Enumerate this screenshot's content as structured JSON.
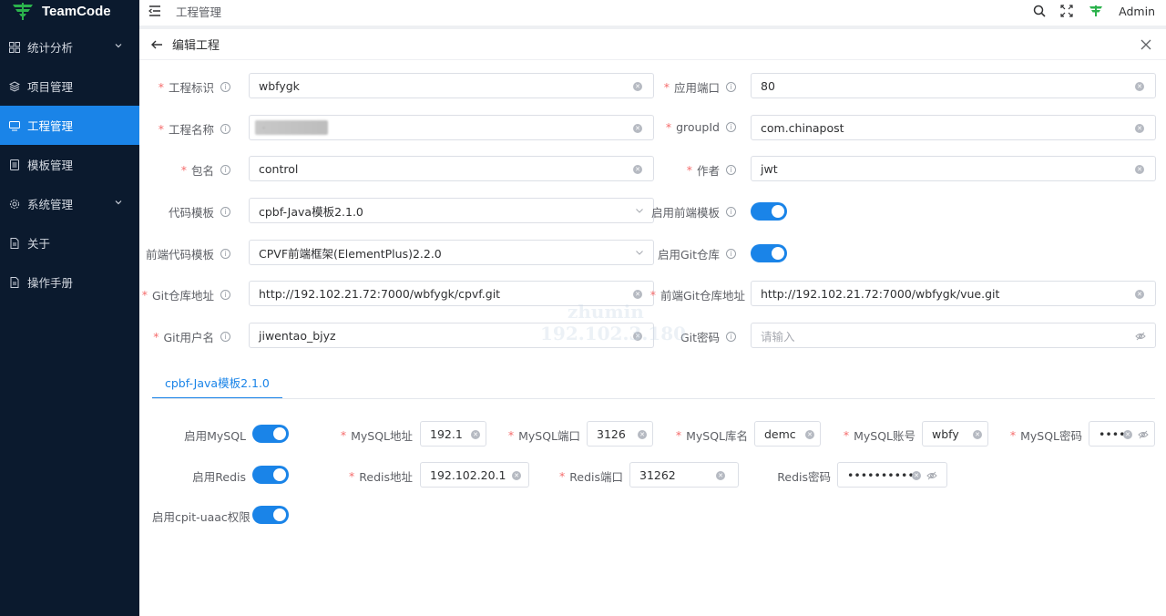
{
  "app": {
    "logo_text": "TeamCode"
  },
  "sidebar": {
    "items": [
      {
        "label": "统计分析",
        "icon": "grid-icon",
        "has_children": true,
        "active": false
      },
      {
        "label": "项目管理",
        "icon": "layers-icon",
        "has_children": false,
        "active": false
      },
      {
        "label": "工程管理",
        "icon": "monitor-icon",
        "has_children": false,
        "active": true
      },
      {
        "label": "模板管理",
        "icon": "file-list-icon",
        "has_children": false,
        "active": false
      },
      {
        "label": "系统管理",
        "icon": "gear-icon",
        "has_children": true,
        "active": false
      },
      {
        "label": "关于",
        "icon": "document-icon",
        "has_children": false,
        "active": false
      },
      {
        "label": "操作手册",
        "icon": "document-icon",
        "has_children": false,
        "active": false
      }
    ]
  },
  "header": {
    "breadcrumb": "工程管理",
    "user": "Admin"
  },
  "page": {
    "title": "编辑工程"
  },
  "form": {
    "project_id": {
      "label": "工程标识",
      "value": "wbfygk"
    },
    "port": {
      "label": "应用端口",
      "value": "80"
    },
    "project_name": {
      "label": "工程名称",
      "value": "·"
    },
    "group_id": {
      "label": "groupId",
      "value": "com.chinapost"
    },
    "package": {
      "label": "包名",
      "value": "control"
    },
    "author": {
      "label": "作者",
      "value": "jwt"
    },
    "code_template": {
      "label": "代码模板",
      "value": "cpbf-Java模板2.1.0"
    },
    "enable_front_template": {
      "label": "启用前端模板",
      "on": true
    },
    "front_template": {
      "label": "前端代码模板",
      "value": "CPVF前端框架(ElementPlus)2.2.0"
    },
    "enable_git": {
      "label": "启用Git仓库",
      "on": true
    },
    "git_url": {
      "label": "Git仓库地址",
      "value": "http://192.102.21.72:7000/wbfygk/cpvf.git"
    },
    "front_git_url": {
      "label": "前端Git仓库地址",
      "value": "http://192.102.21.72:7000/wbfygk/vue.git"
    },
    "git_user": {
      "label": "Git用户名",
      "value": "jiwentao_bjyz"
    },
    "git_password": {
      "label": "Git密码",
      "placeholder": "请输入"
    }
  },
  "tab": {
    "label": "cpbf-Java模板2.1.0"
  },
  "template_form": {
    "enable_mysql": {
      "label": "启用MySQL",
      "on": true
    },
    "mysql_host": {
      "label": "MySQL地址",
      "value": "192.1"
    },
    "mysql_port": {
      "label": "MySQL端口",
      "value": "3126"
    },
    "mysql_db": {
      "label": "MySQL库名",
      "value": "demc"
    },
    "mysql_user": {
      "label": "MySQL账号",
      "value": "wbfy"
    },
    "mysql_password": {
      "label": "MySQL密码",
      "value": "••••"
    },
    "enable_redis": {
      "label": "启用Redis",
      "on": true
    },
    "redis_host": {
      "label": "Redis地址",
      "value": "192.102.20.1"
    },
    "redis_port": {
      "label": "Redis端口",
      "value": "31262"
    },
    "redis_password": {
      "label": "Redis密码",
      "value": "••••••••••"
    },
    "enable_uaac": {
      "label": "启用cpit-uaac权限",
      "on": true
    }
  },
  "watermark": {
    "line1": "zhumin",
    "line2": "192.102.3.180"
  },
  "colors": {
    "sidebar_bg": "#0b1a2e",
    "accent": "#1a84e8",
    "required": "#f56c6c"
  }
}
